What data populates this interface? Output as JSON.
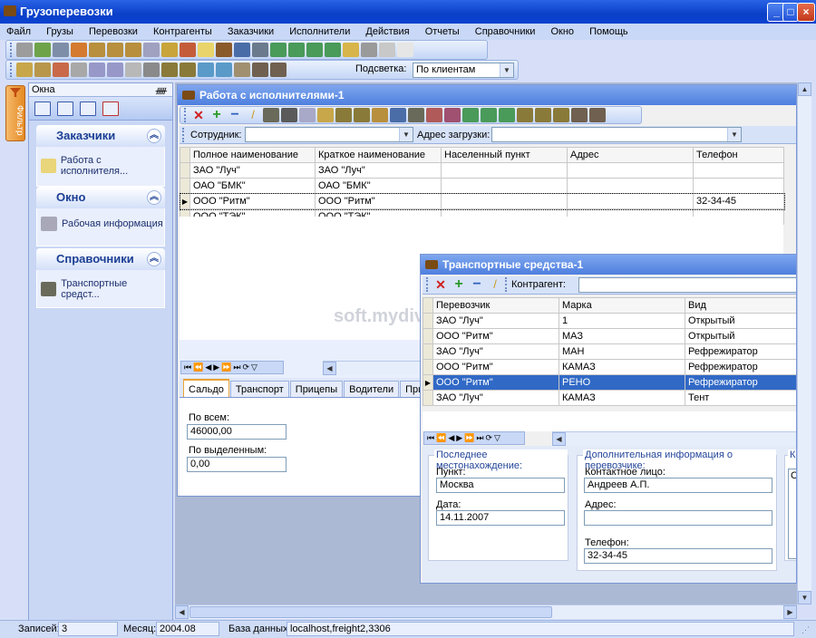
{
  "window": {
    "title": "Грузоперевозки"
  },
  "menu": [
    "Файл",
    "Грузы",
    "Перевозки",
    "Контрагенты",
    "Заказчики",
    "Исполнители",
    "Действия",
    "Отчеты",
    "Справочники",
    "Окно",
    "Помощь"
  ],
  "toolbar2": {
    "highlight_label": "Подсветка:",
    "highlight_value": "По клиентам"
  },
  "filter_tab": {
    "label": "Фильтр"
  },
  "panel": {
    "title": "Окна",
    "groups": [
      {
        "title": "Заказчики",
        "item": "Работа с исполнителя..."
      },
      {
        "title": "Окно",
        "item": "Рабочая информация"
      },
      {
        "title": "Справочники",
        "item": "Транспортные средст..."
      }
    ]
  },
  "win1": {
    "title": "Работа с исполнителями-1",
    "filter_employee_label": "Сотрудник:",
    "filter_address_label": "Адрес загрузки:",
    "columns": [
      "Полное наименование",
      "Краткое наименование",
      "Населенный пункт",
      "Адрес",
      "Телефон"
    ],
    "rows": [
      [
        "ЗАО \"Луч\"",
        "ЗАО \"Луч\"",
        "",
        "",
        ""
      ],
      [
        "ОАО \"БМК\"",
        "ОАО \"БМК\"",
        "",
        "",
        ""
      ],
      [
        "ООО \"Ритм\"",
        "ООО \"Ритм\"",
        "",
        "",
        "32-34-45"
      ],
      [
        "ООО \"ТЭК\"",
        "ООО \"ТЭК\"",
        "",
        "",
        ""
      ]
    ],
    "tabs": [
      "Сальдо",
      "Транспорт",
      "Прицепы",
      "Водители",
      "Привязки"
    ],
    "total_label": "По всем:",
    "total_value": "46000,00",
    "selected_label": "По выделенным:",
    "selected_value": "0,00"
  },
  "win2": {
    "title": "Транспортные средства-1",
    "contragent_label": "Контрагент:",
    "columns": [
      "Перевозчик",
      "Марка",
      "Вид"
    ],
    "rows": [
      [
        "ЗАО \"Луч\"",
        "1",
        "Открытый"
      ],
      [
        "ООО \"Ритм\"",
        "МАЗ",
        "Открытый"
      ],
      [
        "ЗАО \"Луч\"",
        "МАН",
        "Рефрежиратор"
      ],
      [
        "ООО \"Ритм\"",
        "КАМАЗ",
        "Рефрежиратор"
      ],
      [
        "ООО \"Ритм\"",
        "РЕНО",
        "Рефрежиратор"
      ],
      [
        "ЗАО \"Луч\"",
        "КАМАЗ",
        "Тент"
      ]
    ],
    "last_location_title": "Последнее местонахождение:",
    "point_label": "Пункт:",
    "point_value": "Москва",
    "date_label": "Дата:",
    "date_value": "14.11.2007",
    "extra_info_title": "Дополнительная информация о перевозчике:",
    "contact_label": "Контактное лицо:",
    "contact_value": "Андреев А.П.",
    "address_label": "Адрес:",
    "address_value": "",
    "phone_label": "Телефон:",
    "phone_value": "32-34-45",
    "third_group_partial": "К",
    "third_group_field_partial": "С"
  },
  "watermark": "soft.mydiv.net",
  "status": {
    "records_label": "Записей:",
    "records_value": "3",
    "month_label": "Месяц:",
    "month_value": "2004.08",
    "db_label": "База данных:",
    "db_value": "localhost,freight2,3306"
  }
}
